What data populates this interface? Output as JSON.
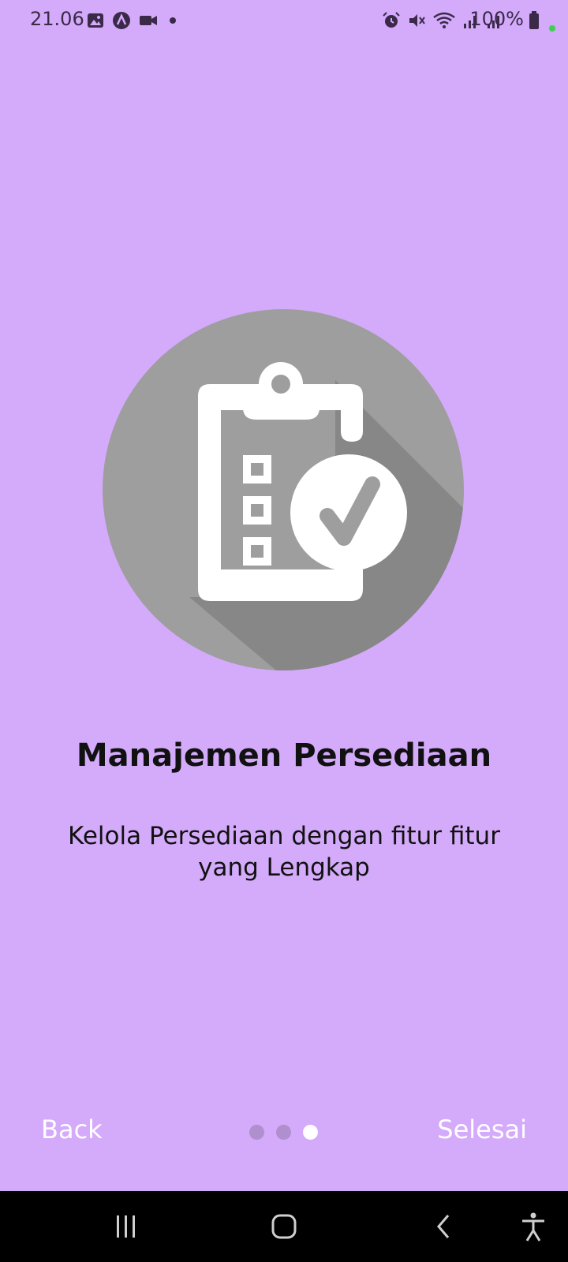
{
  "status_bar": {
    "time": "21.06",
    "battery_text": "100%",
    "left_icons": [
      "image-icon",
      "app-a-icon",
      "video-icon",
      "dot-icon"
    ],
    "right_icons": [
      "alarm-icon",
      "mute-icon",
      "wifi-icon",
      "signal-icon",
      "signal-icon"
    ]
  },
  "onboarding": {
    "illustration_icon": "clipboard-checklist-icon",
    "title": "Manajemen Persediaan",
    "description": "Kelola Persediaan dengan fitur fitur yang Lengkap",
    "back_label": "Back",
    "finish_label": "Selesai",
    "page_count": 3,
    "current_page": 3
  },
  "nav_bar": {
    "items": [
      "recent-apps-icon",
      "home-icon",
      "back-icon",
      "accessibility-icon"
    ]
  },
  "colors": {
    "background": "#d4aafa",
    "circle": "#9e9e9e",
    "shadow": "#868686",
    "dot_inactive": "#b08fce",
    "dot_active": "#ffffff"
  }
}
